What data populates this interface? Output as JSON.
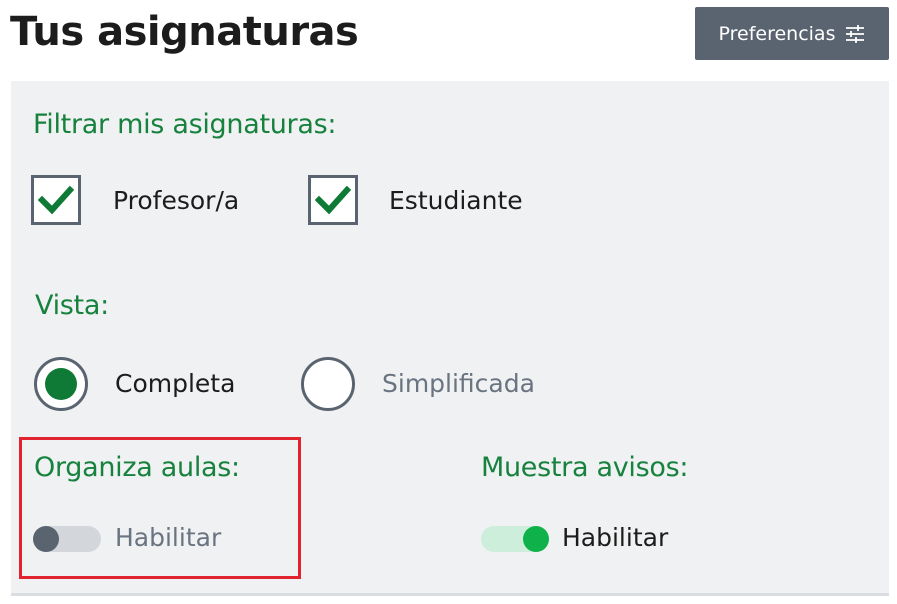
{
  "header": {
    "title": "Tus asignaturas",
    "preferences_label": "Preferencias",
    "preferences_icon": "sliders-icon"
  },
  "filters": {
    "label": "Filtrar mis asignaturas:",
    "options": [
      {
        "label": "Profesor/a",
        "checked": true
      },
      {
        "label": "Estudiante",
        "checked": true
      }
    ]
  },
  "view": {
    "label": "Vista:",
    "options": [
      {
        "label": "Completa",
        "selected": true
      },
      {
        "label": "Simplificada",
        "selected": false
      }
    ]
  },
  "organize": {
    "label": "Organiza aulas:",
    "toggle_label": "Habilitar",
    "enabled": false
  },
  "notices": {
    "label": "Muestra avisos:",
    "toggle_label": "Habilitar",
    "enabled": true
  },
  "colors": {
    "accent_green": "#17823d",
    "toggle_on": "#0fb14a",
    "button_bg": "#5a6470",
    "highlight": "#e0232e"
  }
}
